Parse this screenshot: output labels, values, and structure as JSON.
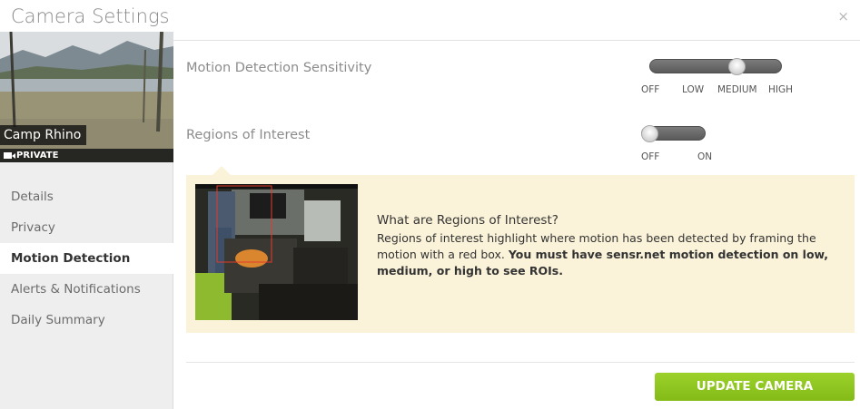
{
  "header": {
    "title": "Camera Settings",
    "close_glyph": "×"
  },
  "camera": {
    "name": "Camp Rhino",
    "privacy": "PRIVATE"
  },
  "sidebar": {
    "items": [
      {
        "label": "Details"
      },
      {
        "label": "Privacy"
      },
      {
        "label": "Motion Detection",
        "active": true
      },
      {
        "label": "Alerts & Notifications"
      },
      {
        "label": "Daily Summary"
      }
    ]
  },
  "motion_sensitivity": {
    "label": "Motion Detection Sensitivity",
    "options": [
      "OFF",
      "LOW",
      "MEDIUM",
      "HIGH"
    ],
    "selected": "MEDIUM"
  },
  "regions_of_interest": {
    "label": "Regions of Interest",
    "options": [
      "OFF",
      "ON"
    ],
    "selected": "OFF"
  },
  "info_box": {
    "title": "What are Regions of Interest?",
    "body": "Regions of interest highlight where motion has been detected by framing the motion with a red box.",
    "body_bold": "You must have sensr.net motion detection on low, medium, or high to see ROIs."
  },
  "update_button": {
    "label": "UPDATE CAMERA"
  },
  "colors": {
    "accent_green": "#8cc21f",
    "info_bg": "#fbf3d9",
    "sidebar_bg": "#eeeeee"
  }
}
